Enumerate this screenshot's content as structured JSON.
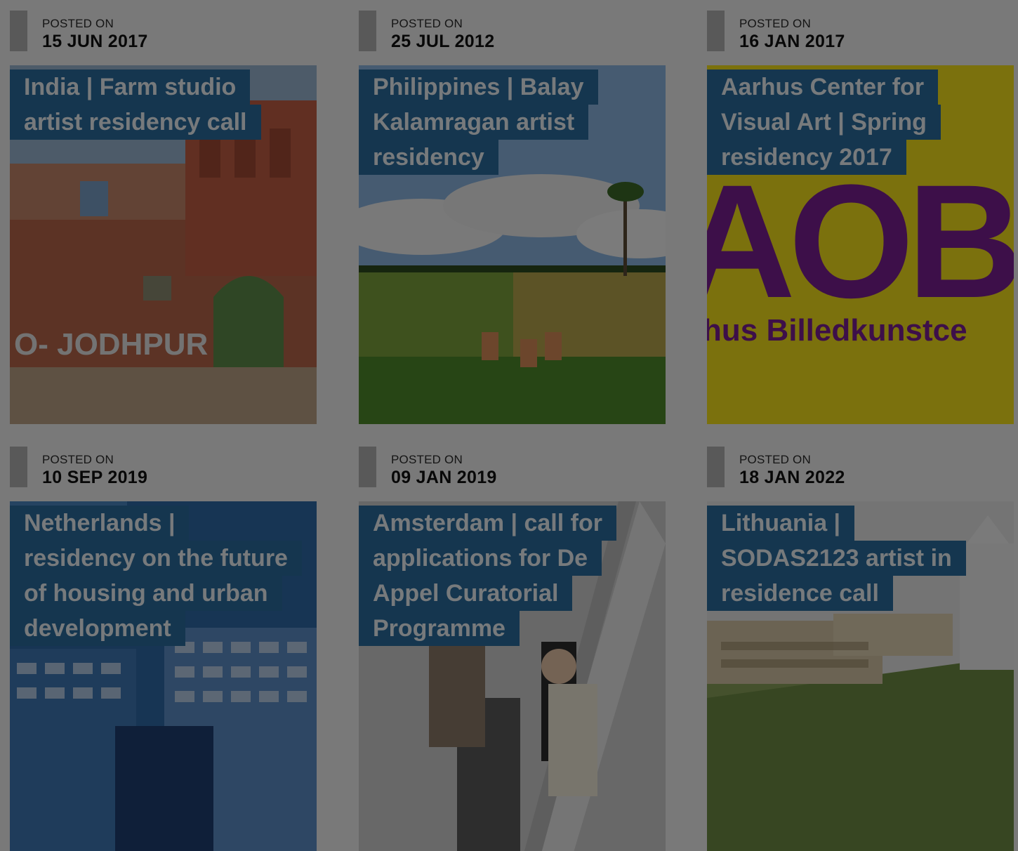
{
  "posted_label": "POSTED ON",
  "posts": [
    {
      "date": "15 JUN 2017",
      "title_lines": [
        "India | Farm studio",
        "artist residency call"
      ],
      "image_text": "O- JODHPUR"
    },
    {
      "date": "25 JUL 2012",
      "title_lines": [
        "Philippines | Balay",
        "Kalamragan artist",
        "residency"
      ]
    },
    {
      "date": "16 JAN 2017",
      "title_lines": [
        "Aarhus Center for",
        "Visual Art | Spring",
        "residency 2017"
      ],
      "image_text": [
        "AOBK",
        "hus Billedkunstce"
      ]
    },
    {
      "date": "10 SEP 2019",
      "title_lines": [
        "Netherlands |",
        "residency on the future",
        "of housing and urban",
        "development"
      ]
    },
    {
      "date": "09 JAN 2019",
      "title_lines": [
        "Amsterdam | call for",
        "applications for De",
        "Appel Curatorial",
        "Programme"
      ]
    },
    {
      "date": "18 JAN 2022",
      "title_lines": [
        "Lithuania |",
        "SODAS2123 artist in",
        "residence call"
      ]
    }
  ],
  "colors": {
    "title_bg": "#2b6d9f",
    "date_bar": "#b3b3b3",
    "overlay": "rgba(0,0,0,0.5)"
  }
}
